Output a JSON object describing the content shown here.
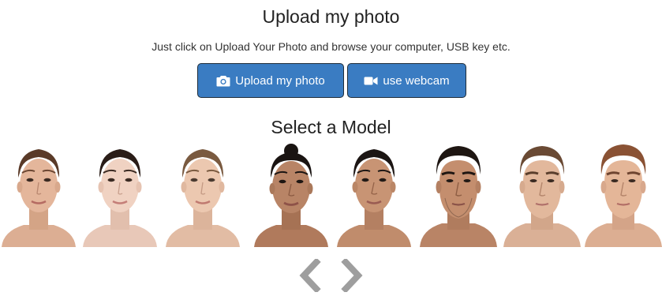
{
  "upload": {
    "title": "Upload my photo",
    "subtitle": "Just click on Upload Your Photo and browse your computer, USB key etc.",
    "upload_button_label": "Upload my photo",
    "webcam_button_label": "use webcam",
    "upload_icon": "camera-icon",
    "webcam_icon": "video-camera-icon"
  },
  "models": {
    "title": "Select a Model",
    "items": [
      {
        "gender": "female",
        "hair": "brown-slicked"
      },
      {
        "gender": "female",
        "hair": "dark-slicked"
      },
      {
        "gender": "female",
        "hair": "light-brown-slicked"
      },
      {
        "gender": "female",
        "hair": "black-bun"
      },
      {
        "gender": "female",
        "hair": "black-slicked"
      },
      {
        "gender": "male",
        "hair": "black-short"
      },
      {
        "gender": "male",
        "hair": "brown-short"
      },
      {
        "gender": "male",
        "hair": "auburn-short"
      }
    ]
  },
  "navigation": {
    "prev_icon": "chevron-left-icon",
    "next_icon": "chevron-right-icon"
  },
  "colors": {
    "button_bg": "#3a7cc2",
    "button_border": "#1f2d3a",
    "chevron": "#9e9e9e"
  }
}
